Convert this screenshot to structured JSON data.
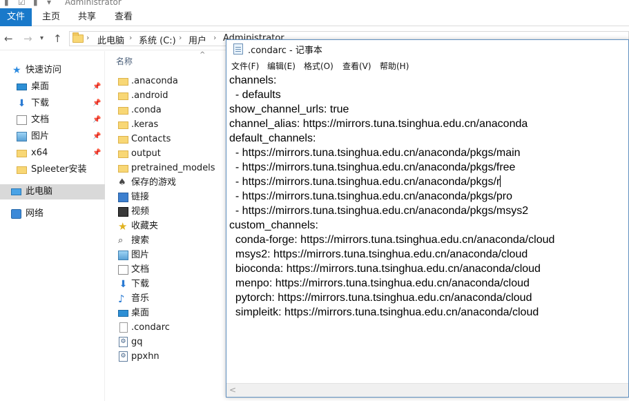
{
  "explorer": {
    "window_title": "Administrator",
    "ribbon_tabs": [
      {
        "label": "文件"
      },
      {
        "label": "主页"
      },
      {
        "label": "共享"
      },
      {
        "label": "查看"
      }
    ],
    "address": {
      "crumbs": [
        "此电脑",
        "系统 (C:)",
        "用户",
        "Administrator"
      ]
    },
    "nav_pane": {
      "items": [
        {
          "label": "快速访问",
          "icon": "star-icon"
        },
        {
          "label": "桌面",
          "icon": "desktop-icon",
          "pinned": true
        },
        {
          "label": "下载",
          "icon": "download-icon",
          "pinned": true
        },
        {
          "label": "文档",
          "icon": "documents-icon",
          "pinned": true
        },
        {
          "label": "图片",
          "icon": "pictures-icon",
          "pinned": true
        },
        {
          "label": "x64",
          "icon": "folder-icon",
          "pinned": true
        },
        {
          "label": "Spleeter安装",
          "icon": "folder-icon"
        },
        {
          "label": "此电脑",
          "icon": "pc-icon",
          "selected": true
        },
        {
          "label": "网络",
          "icon": "network-icon"
        }
      ]
    },
    "file_list": {
      "column_name": "名称",
      "items": [
        {
          "label": ".anaconda",
          "icon": "folder-icon"
        },
        {
          "label": ".android",
          "icon": "folder-icon"
        },
        {
          "label": ".conda",
          "icon": "folder-icon"
        },
        {
          "label": ".keras",
          "icon": "folder-icon"
        },
        {
          "label": "Contacts",
          "icon": "contacts-icon"
        },
        {
          "label": "output",
          "icon": "folder-icon"
        },
        {
          "label": "pretrained_models",
          "icon": "folder-icon"
        },
        {
          "label": "保存的游戏",
          "icon": "saved-games-icon"
        },
        {
          "label": "链接",
          "icon": "links-icon"
        },
        {
          "label": "视频",
          "icon": "videos-icon"
        },
        {
          "label": "收藏夹",
          "icon": "favorites-icon"
        },
        {
          "label": "搜索",
          "icon": "searches-icon"
        },
        {
          "label": "图片",
          "icon": "pictures-icon"
        },
        {
          "label": "文档",
          "icon": "documents-icon"
        },
        {
          "label": "下载",
          "icon": "download-icon"
        },
        {
          "label": "音乐",
          "icon": "music-icon"
        },
        {
          "label": "桌面",
          "icon": "desktop-icon"
        },
        {
          "label": ".condarc",
          "icon": "file-icon"
        },
        {
          "label": "gq",
          "icon": "batch-file-icon"
        },
        {
          "label": "ppxhn",
          "icon": "batch-file-icon"
        }
      ]
    }
  },
  "notepad": {
    "title": ".condarc - 记事本",
    "menu": [
      "文件(F)",
      "编辑(E)",
      "格式(O)",
      "查看(V)",
      "帮助(H)"
    ],
    "lines": [
      "channels:",
      "  - defaults",
      "show_channel_urls: true",
      "channel_alias: https://mirrors.tuna.tsinghua.edu.cn/anaconda",
      "default_channels:",
      "  - https://mirrors.tuna.tsinghua.edu.cn/anaconda/pkgs/main",
      "  - https://mirrors.tuna.tsinghua.edu.cn/anaconda/pkgs/free",
      "  - https://mirrors.tuna.tsinghua.edu.cn/anaconda/pkgs/r",
      "  - https://mirrors.tuna.tsinghua.edu.cn/anaconda/pkgs/pro",
      "  - https://mirrors.tuna.tsinghua.edu.cn/anaconda/pkgs/msys2",
      "custom_channels:",
      "  conda-forge: https://mirrors.tuna.tsinghua.edu.cn/anaconda/cloud",
      "  msys2: https://mirrors.tuna.tsinghua.edu.cn/anaconda/cloud",
      "  bioconda: https://mirrors.tuna.tsinghua.edu.cn/anaconda/cloud",
      "  menpo: https://mirrors.tuna.tsinghua.edu.cn/anaconda/cloud",
      "  pytorch: https://mirrors.tuna.tsinghua.edu.cn/anaconda/cloud",
      "  simpleitk: https://mirrors.tuna.tsinghua.edu.cn/anaconda/cloud"
    ]
  },
  "colors": {
    "file_tab": "#1979ca",
    "selection": "#d9d9d9",
    "folder": "#f8d775"
  }
}
